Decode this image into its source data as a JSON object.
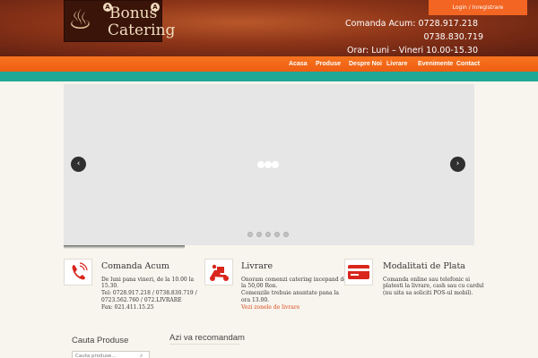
{
  "header": {
    "logo": {
      "line1": "Bonus",
      "line2": "Catering",
      "badge": "A"
    },
    "login_label": "Login / Inregistrare",
    "contact": {
      "order_line": "Comanda Acum: 0728.917.218",
      "phone2": "0738.830.719",
      "hours": "Orar: Luni – Vineri 10.00-15.30"
    }
  },
  "nav": {
    "items": [
      {
        "label": "Acasa"
      },
      {
        "label": "Produse"
      },
      {
        "label": "Despre Noi"
      },
      {
        "label": "Livrare"
      },
      {
        "label": "Evenimente"
      },
      {
        "label": "Contact"
      }
    ],
    "color": "#f26522"
  },
  "accent_teal": "#1fa896",
  "slider": {
    "prev_icon": "chevron-left-icon",
    "next_icon": "chevron-right-icon",
    "slide_count": 5
  },
  "info": [
    {
      "icon": "phone-icon",
      "title": "Comanda Acum",
      "lines": [
        "De luni pana vineri, de la 10.00 la",
        "15.30.",
        "Tel: 0728.917.218 / 0738.830.719 /",
        "0723.562.760 / 072.LIVRARE",
        "Fax: 021.411.15.25"
      ]
    },
    {
      "icon": "scooter-icon",
      "title": "Livrare",
      "lines": [
        "Onoram comenzi catering incepand de",
        "la 50,00 Ron.",
        "Comenzile trebuie anuntate pana la",
        "ora 13.00."
      ],
      "link": "Vezi zonele de livrare"
    },
    {
      "icon": "card-icon",
      "title": "Modalitati de Plata",
      "lines": [
        "Comanda online sau telefonic si",
        "platesti la livrare, cash sau cu cardul",
        "(nu uita sa soliciti POS-ul mobil)."
      ]
    }
  ],
  "sidebar": {
    "title": "Cauta Produse",
    "search_placeholder": "Cauta produse..."
  },
  "recommend": {
    "title": "Azi va recomandam"
  }
}
